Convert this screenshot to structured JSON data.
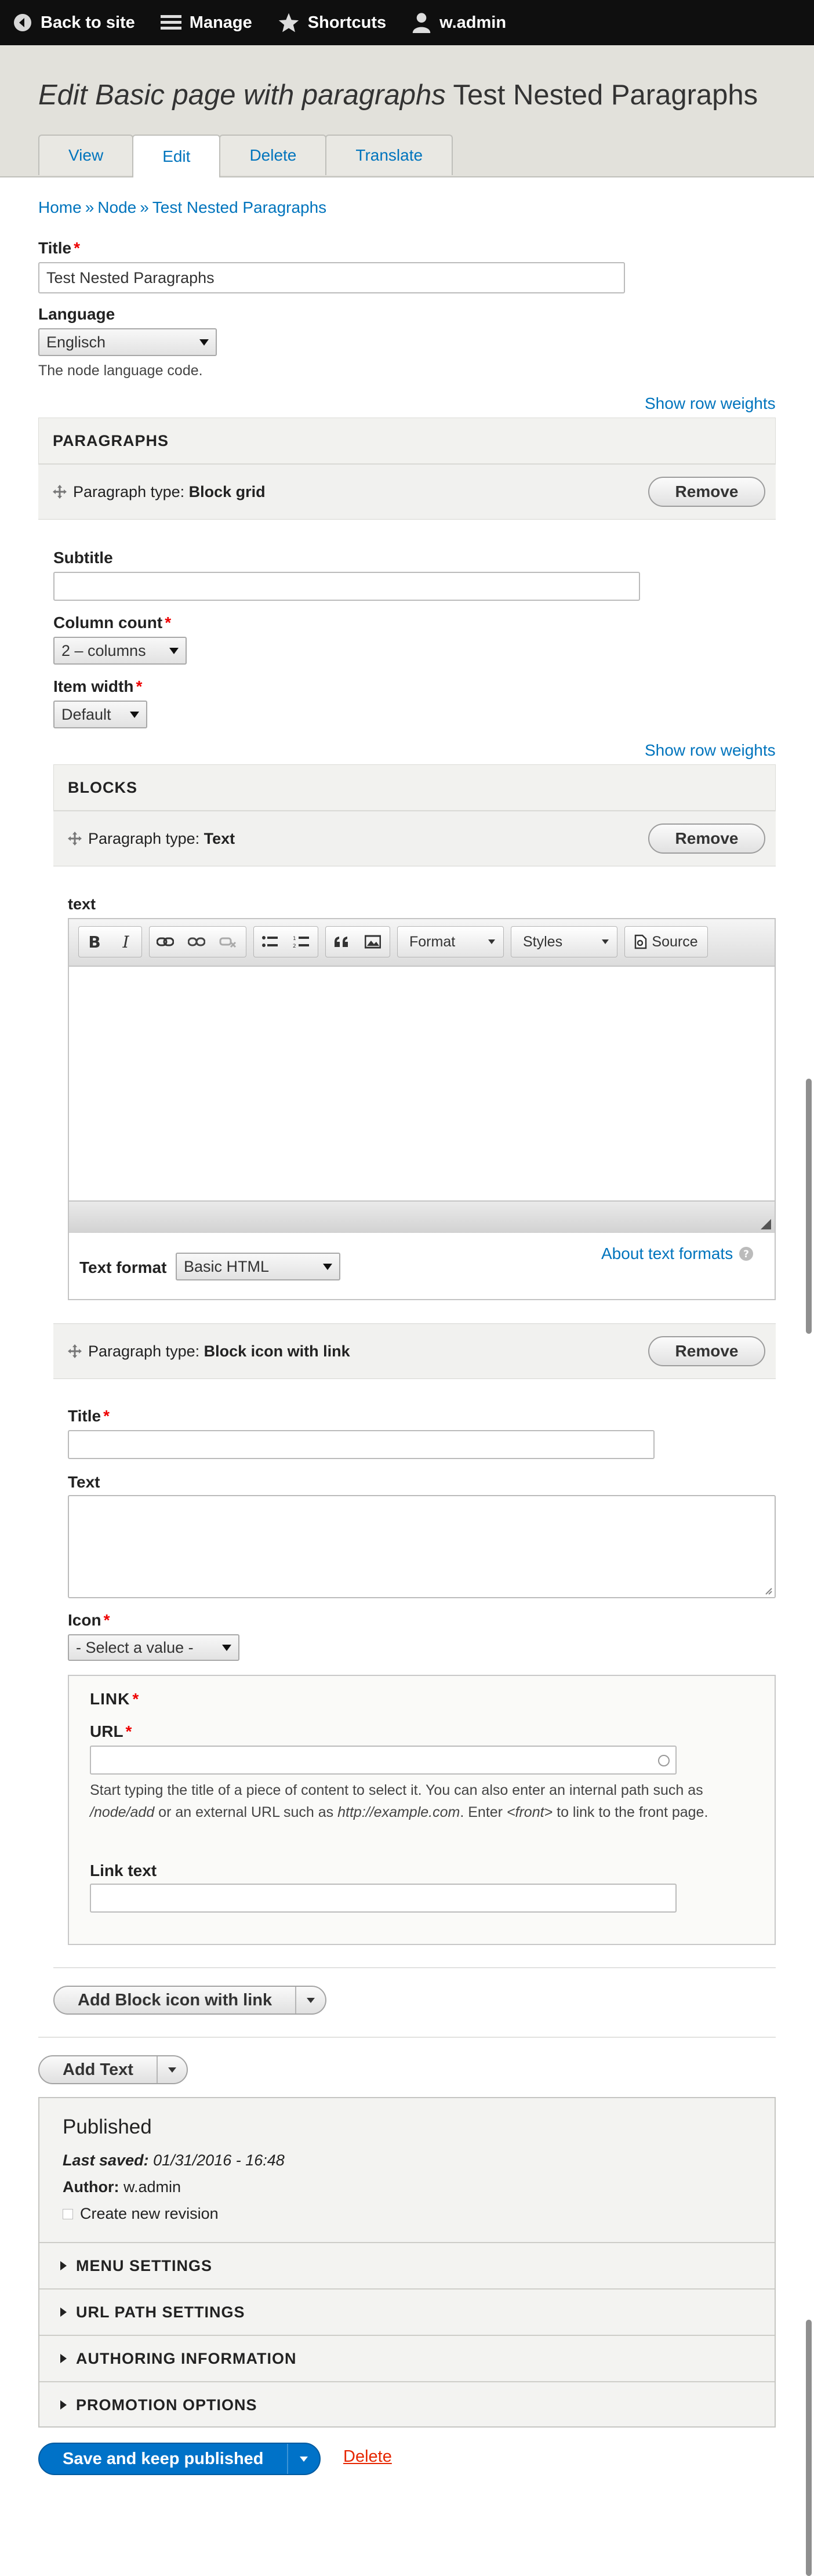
{
  "toolbar": {
    "back": "Back to site",
    "manage": "Manage",
    "shortcuts": "Shortcuts",
    "user": "w.admin"
  },
  "header": {
    "title_prefix": "Edit Basic page with paragraphs",
    "title_node": "Test Nested Paragraphs",
    "tabs": [
      "View",
      "Edit",
      "Delete",
      "Translate"
    ]
  },
  "breadcrumb": [
    "Home",
    "Node",
    "Test Nested Paragraphs"
  ],
  "breadcrumb_sep": "»",
  "title_field": {
    "label": "Title",
    "value": "Test Nested Paragraphs"
  },
  "language": {
    "label": "Language",
    "value": "Englisch",
    "description": "The node language code."
  },
  "show_row_weights": "Show row weights",
  "paragraphs": {
    "heading": "PARAGRAPHS",
    "ptype_prefix": "Paragraph type:",
    "remove": "Remove",
    "block_grid": {
      "type": "Block grid",
      "subtitle_label": "Subtitle",
      "column_count_label": "Column count",
      "column_count_value": "2 – columns",
      "item_width_label": "Item width",
      "item_width_value": "Default",
      "blocks_heading": "BLOCKS"
    },
    "text_block": {
      "type": "Text",
      "field_label": "text",
      "editor": {
        "format_combo": "Format",
        "styles_combo": "Styles",
        "source": "Source"
      },
      "text_format_label": "Text format",
      "text_format_value": "Basic HTML",
      "about_formats": "About text formats"
    },
    "icon_block": {
      "type": "Block icon with link",
      "title_label": "Title",
      "text_label": "Text",
      "icon_label": "Icon",
      "icon_value": "- Select a value -",
      "link_heading": "LINK",
      "url_label": "URL",
      "url_help": {
        "p1": "Start typing the title of a piece of content to select it. You can also enter an internal path such as ",
        "c1": "/node/add",
        "p2": " or an external URL such as ",
        "c2": "http://example.com",
        "p3": ". Enter ",
        "c3": "<front>",
        "p4": " to link to the front page."
      },
      "link_text_label": "Link text"
    },
    "add_icon_block": "Add Block icon with link",
    "add_text": "Add Text"
  },
  "meta": {
    "status": "Published",
    "last_saved_label": "Last saved:",
    "last_saved_value": "01/31/2016 - 16:48",
    "author_label": "Author:",
    "author_value": "w.admin",
    "new_revision": "Create new revision",
    "sections": [
      "MENU SETTINGS",
      "URL PATH SETTINGS",
      "AUTHORING INFORMATION",
      "PROMOTION OPTIONS"
    ]
  },
  "actions": {
    "save": "Save and keep published",
    "delete": "Delete"
  },
  "colors": {
    "accent": "#0074bd",
    "primary_button": "#0072c8",
    "delete": "#e62600",
    "required": "#ee0000"
  }
}
